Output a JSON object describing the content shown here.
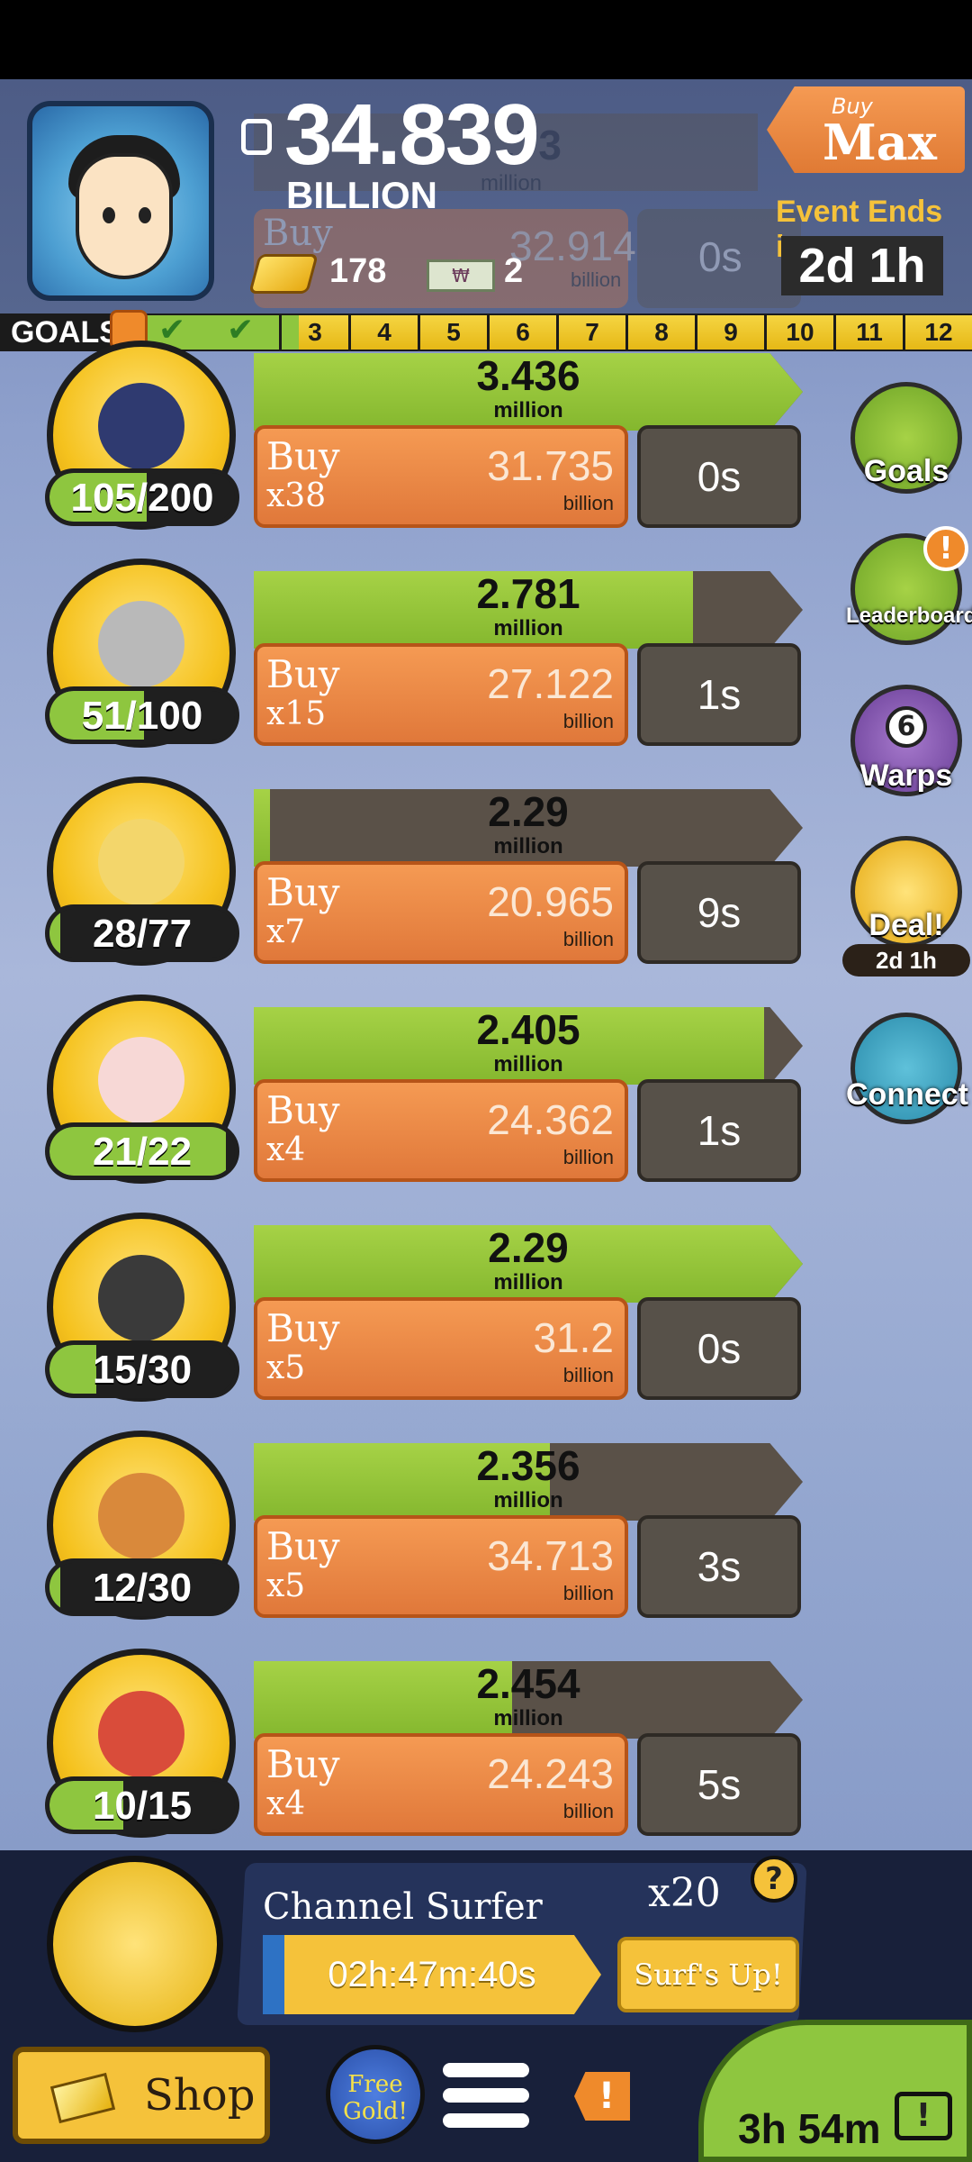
{
  "header": {
    "money_amount": "34.839",
    "money_unit": "BILLION",
    "gold_count": "178",
    "ticket_count": "2",
    "ticket_symbol": "₩",
    "buy_max_small": "Buy",
    "buy_max_big": "Max",
    "event_label": "Event Ends in:",
    "event_timer": "2d 1h"
  },
  "ghost_row": {
    "progress": ".73",
    "progress_unit": "million",
    "buy": "Buy",
    "price": "32.914",
    "unit": "billion",
    "timer": "0s"
  },
  "goals": {
    "label": "GOALS",
    "numbers": [
      "3",
      "4",
      "5",
      "6",
      "7",
      "8",
      "9",
      "10",
      "11",
      "12"
    ]
  },
  "shows": [
    {
      "owned": "105/200",
      "owned_fraction": 0.525,
      "progress": "3.436",
      "progress_unit": "million",
      "progress_fraction": 1.0,
      "buy": "Buy",
      "mult": "x38",
      "price": "31.735",
      "price_unit": "billion",
      "timer": "0s",
      "icon": "black-hole-icon"
    },
    {
      "owned": "51/100",
      "owned_fraction": 0.51,
      "progress": "2.781",
      "progress_unit": "million",
      "progress_fraction": 0.8,
      "buy": "Buy",
      "mult": "x15",
      "price": "27.122",
      "price_unit": "billion",
      "timer": "1s",
      "icon": "mlb-badge-icon"
    },
    {
      "owned": "28/77",
      "owned_fraction": 0.06,
      "progress": "2.29",
      "progress_unit": "million",
      "progress_fraction": 0.03,
      "buy": "Buy",
      "mult": "x7",
      "price": "20.965",
      "price_unit": "billion",
      "timer": "9s",
      "icon": "mouse-car-icon"
    },
    {
      "owned": "21/22",
      "owned_fraction": 0.95,
      "progress": "2.405",
      "progress_unit": "million",
      "progress_fraction": 0.93,
      "buy": "Buy",
      "mult": "x4",
      "price": "24.362",
      "price_unit": "billion",
      "timer": "1s",
      "icon": "disco-mouse-icon"
    },
    {
      "owned": "15/30",
      "owned_fraction": 0.25,
      "progress": "2.29",
      "progress_unit": "million",
      "progress_fraction": 1.0,
      "buy": "Buy",
      "mult": "x5",
      "price": "31.2",
      "price_unit": "billion",
      "timer": "0s",
      "icon": "tj-radio-icon"
    },
    {
      "owned": "12/30",
      "owned_fraction": 0.06,
      "progress": "2.356",
      "progress_unit": "million",
      "progress_fraction": 0.54,
      "buy": "Buy",
      "mult": "x5",
      "price": "34.713",
      "price_unit": "billion",
      "timer": "3s",
      "icon": "teddy-bear-icon"
    },
    {
      "owned": "10/15",
      "owned_fraction": 0.4,
      "progress": "2.454",
      "progress_unit": "million",
      "progress_fraction": 0.47,
      "buy": "Buy",
      "mult": "x4",
      "price": "24.243",
      "price_unit": "billion",
      "timer": "5s",
      "icon": "pizza-rat-icon"
    }
  ],
  "side": {
    "goals": "Goals",
    "leaderboard": "Leaderboard",
    "leaderboard_alert": "!",
    "warps_count": "6",
    "warps": "Warps",
    "deal": "Deal!",
    "deal_timer": "2d 1h",
    "connect": "Connect"
  },
  "surfer": {
    "title": "Channel Surfer",
    "multiplier": "x20",
    "help": "?",
    "timer": "02h:47m:40s",
    "button": "Surf's Up!"
  },
  "bottom": {
    "shop": "Shop",
    "free_gold_line1": "Free",
    "free_gold_line2": "Gold!",
    "alert": "!",
    "tv_timer": "3h 54m",
    "tv_alert": "!"
  },
  "colors": {
    "green": "#8ec63f",
    "orange": "#e0783a",
    "gold": "#f5c23a",
    "dark": "#575149"
  }
}
